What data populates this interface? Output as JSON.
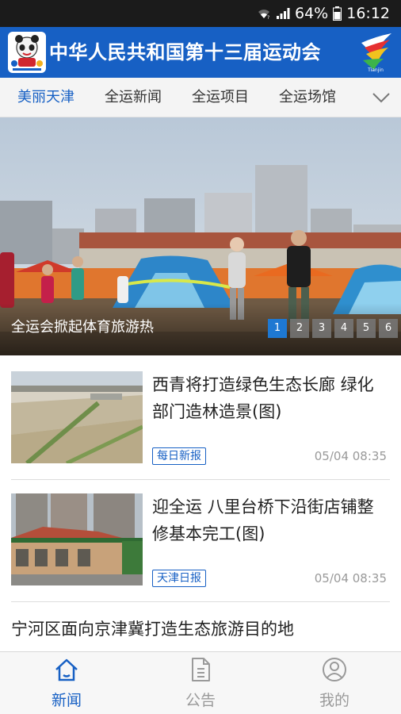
{
  "status_bar": {
    "battery": "64%",
    "time": "16:12",
    "icons": [
      "wifi-icon",
      "signal-icon",
      "battery-icon"
    ]
  },
  "header": {
    "title": "中华人民共和国第十三届运动会",
    "background": "#1760c4"
  },
  "tabs": [
    {
      "label": "美丽天津",
      "active": true
    },
    {
      "label": "全运新闻",
      "active": false
    },
    {
      "label": "全运项目",
      "active": false
    },
    {
      "label": "全运场馆",
      "active": false
    }
  ],
  "banner": {
    "caption": "全运会掀起体育旅游热",
    "pages": [
      "1",
      "2",
      "3",
      "4",
      "5",
      "6"
    ],
    "active_page": 1
  },
  "news": [
    {
      "title": "西青将打造绿色生态长廊 绿化部门造林造景(图)",
      "source": "每日新报",
      "time": "05/04 08:35"
    },
    {
      "title": "迎全运 八里台桥下沿街店铺整修基本完工(图)",
      "source": "天津日报",
      "time": "05/04 08:35"
    },
    {
      "title": "宁河区面向京津冀打造生态旅游目的地"
    }
  ],
  "bottom_nav": [
    {
      "label": "新闻",
      "icon": "home-icon",
      "active": true
    },
    {
      "label": "公告",
      "icon": "document-icon",
      "active": false
    },
    {
      "label": "我的",
      "icon": "user-icon",
      "active": false
    }
  ],
  "colors": {
    "accent": "#1760c4",
    "status_bar": "#1b1b1b",
    "active_dot": "#1e78d2"
  }
}
